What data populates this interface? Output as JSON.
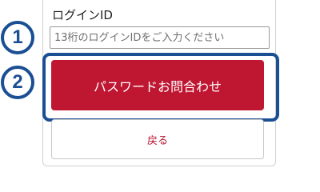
{
  "form": {
    "login_id_label": "ログインID",
    "login_id_value": "",
    "login_id_placeholder": "13桁のログインIDをご入力ください",
    "inquiry_button_label": "パスワードお問合わせ",
    "back_button_label": "戻る"
  },
  "steps": [
    "1",
    "2"
  ],
  "colors": {
    "primary_button": "#bf1632",
    "back_text": "#b8172f",
    "step_badge": "#1b4f93",
    "highlight_frame": "#1b4f93"
  }
}
